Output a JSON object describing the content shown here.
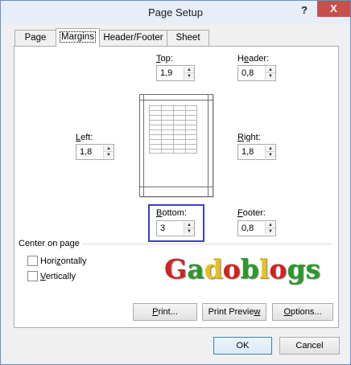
{
  "window": {
    "title": "Page Setup",
    "help_label": "?",
    "close_label": "X"
  },
  "tabs": [
    {
      "label": "Page"
    },
    {
      "label": "Margins"
    },
    {
      "label": "Header/Footer"
    },
    {
      "label": "Sheet"
    }
  ],
  "margins": {
    "top": {
      "label_key": "T",
      "label_rest": "op:",
      "value": "1,9"
    },
    "header": {
      "label_pre": "H",
      "label_key": "e",
      "label_rest": "ader:",
      "value": "0,8"
    },
    "left": {
      "label_key": "L",
      "label_rest": "eft:",
      "value": "1,8"
    },
    "right": {
      "label_key": "R",
      "label_rest": "ight:",
      "value": "1,8"
    },
    "bottom": {
      "label_key": "B",
      "label_rest": "ottom:",
      "value": "3"
    },
    "footer": {
      "label_key": "F",
      "label_rest": "ooter:",
      "value": "0,8"
    }
  },
  "center_on_page": {
    "label": "Center on page",
    "horizontally": {
      "key": "Hori",
      "key_u": "z",
      "rest": "ontally"
    },
    "vertically": {
      "key_u": "V",
      "rest": "ertically"
    }
  },
  "watermark": {
    "letters": [
      {
        "ch": "G",
        "color": "#d62020"
      },
      {
        "ch": "a",
        "color": "#2a9a2a"
      },
      {
        "ch": "d",
        "color": "#e8c020"
      },
      {
        "ch": "o",
        "color": "#d62020"
      },
      {
        "ch": "b",
        "color": "#2a9a2a"
      },
      {
        "ch": "l",
        "color": "#e8c020"
      },
      {
        "ch": "o",
        "color": "#d62020"
      },
      {
        "ch": "g",
        "color": "#2a9a2a"
      },
      {
        "ch": "s",
        "color": "#2a9a2a"
      }
    ]
  },
  "actions": {
    "print": {
      "key_u": "P",
      "rest": "rint..."
    },
    "print_preview": {
      "pre": "Print Previe",
      "key_u": "w",
      "rest": ""
    },
    "options": {
      "key_u": "O",
      "rest": "ptions..."
    }
  },
  "footer_buttons": {
    "ok": "OK",
    "cancel": "Cancel"
  },
  "colors": {
    "highlight_box": "#3f3fbf",
    "close_button": "#c7504c",
    "primary_button_border": "#3c7fb1"
  }
}
